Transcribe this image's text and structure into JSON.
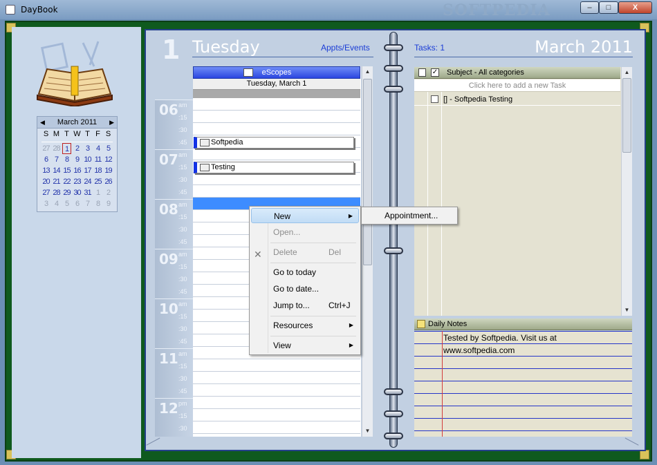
{
  "window": {
    "title": "DayBook",
    "watermark": "SOFTPEDIA",
    "minimize": "–",
    "maximize": "□",
    "close": "X"
  },
  "minical": {
    "month": "March 2011",
    "prev": "◀",
    "next": "▶",
    "dow": [
      "S",
      "M",
      "T",
      "W",
      "T",
      "F",
      "S"
    ],
    "weeks": [
      [
        "27",
        "28",
        "1",
        "2",
        "3",
        "4",
        "5"
      ],
      [
        "6",
        "7",
        "8",
        "9",
        "10",
        "11",
        "12"
      ],
      [
        "13",
        "14",
        "15",
        "16",
        "17",
        "18",
        "19"
      ],
      [
        "20",
        "21",
        "22",
        "23",
        "24",
        "25",
        "26"
      ],
      [
        "27",
        "28",
        "29",
        "30",
        "31",
        "1",
        "2"
      ],
      [
        "3",
        "4",
        "5",
        "6",
        "7",
        "8",
        "9"
      ]
    ]
  },
  "header": {
    "daynum": "1",
    "dayname": "Tuesday",
    "appts_link": "Appts/Events",
    "tasks_link": "Tasks: 1",
    "monthyear": "March 2011"
  },
  "schedule": {
    "resource": "eScopes",
    "date": "Tuesday, March 1",
    "hours": [
      {
        "num": "06",
        "ampm": "am"
      },
      {
        "num": "07",
        "ampm": "am"
      },
      {
        "num": "08",
        "ampm": "am"
      },
      {
        "num": "09",
        "ampm": "am"
      },
      {
        "num": "10",
        "ampm": "am"
      },
      {
        "num": "11",
        "ampm": "am"
      },
      {
        "num": "12",
        "ampm": "pm"
      }
    ],
    "quarters": [
      ":15",
      ":30",
      ":45"
    ],
    "appointments": [
      {
        "label": "Softpedia"
      },
      {
        "label": "Testing"
      }
    ]
  },
  "context_menu": {
    "items": [
      {
        "label": "New",
        "shortcut": "",
        "submenu": true
      },
      {
        "label": "Open...",
        "shortcut": "",
        "disabled": true
      },
      {
        "label": "Delete",
        "shortcut": "Del",
        "disabled": true
      },
      {
        "label": "Go to today",
        "shortcut": ""
      },
      {
        "label": "Go to date...",
        "shortcut": ""
      },
      {
        "label": "Jump to...",
        "shortcut": "Ctrl+J"
      },
      {
        "label": "Resources",
        "shortcut": "",
        "submenu": true
      },
      {
        "label": "View",
        "shortcut": "",
        "submenu": true
      }
    ],
    "submenu": {
      "label": "Appointment..."
    }
  },
  "tasks": {
    "header": "Subject - All categories",
    "add_placeholder": "Click here to add a new Task",
    "items": [
      {
        "label": "[] - Softpedia Testing"
      }
    ]
  },
  "notes": {
    "title": "Daily Notes",
    "lines": [
      "Tested by Softpedia. Visit us at",
      "www.softpedia.com"
    ]
  }
}
